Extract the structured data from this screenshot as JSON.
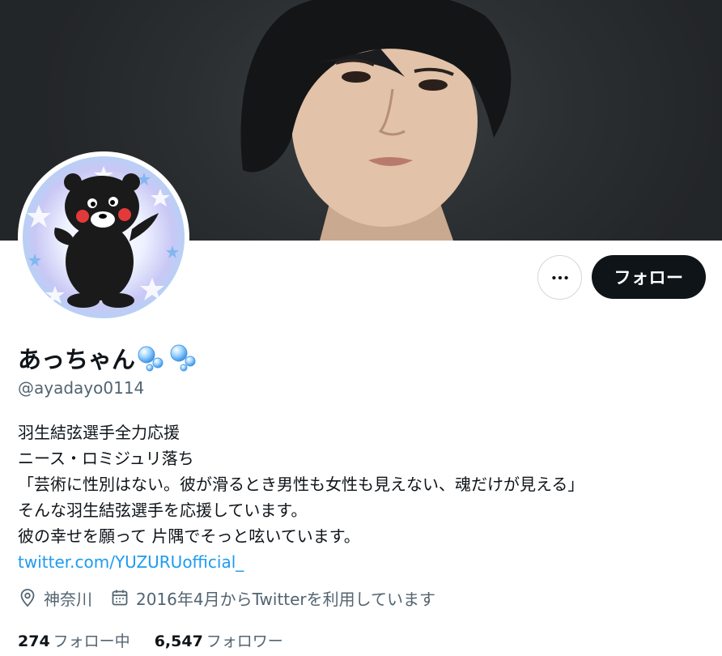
{
  "profile": {
    "display_name": "あっちゃん",
    "handle": "@ayadayo0114",
    "bio_lines": [
      "羽生結弦選手全力応援",
      "ニース・ロミジュリ落ち",
      "「芸術に性別はない。彼が滑るとき男性も女性も見えない、魂だけが見える」",
      "そんな羽生結弦選手を応援しています。",
      "彼の幸せを願って 片隅でそっと呟いています。"
    ],
    "link": "twitter.com/YUZURUofficial_",
    "location": "神奈川",
    "joined": "2016年4月からTwitterを利用しています"
  },
  "actions": {
    "follow_label": "フォロー"
  },
  "stats": {
    "following_count": "274",
    "following_label": "フォロー中",
    "followers_count": "6,547",
    "followers_label": "フォロワー"
  },
  "icons": {
    "more": "more-horizontal-icon",
    "location": "location-pin-icon",
    "calendar": "calendar-icon",
    "name_emoji": "bubbles-emoji-icon"
  },
  "colors": {
    "link": "#1d9bf0",
    "secondary_text": "#536471",
    "follow_button": "#0f1419"
  }
}
